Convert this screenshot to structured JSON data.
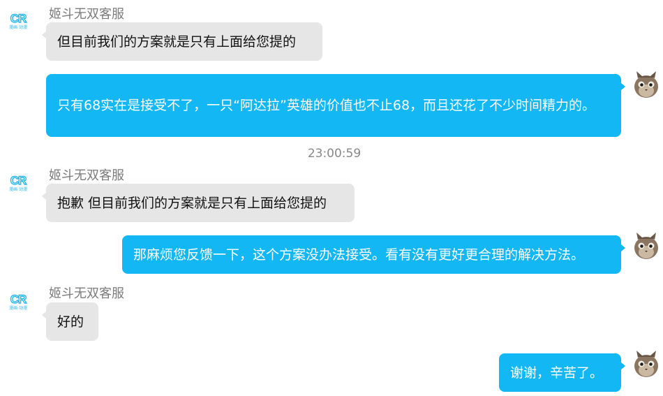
{
  "chat": {
    "agent_name": "姬斗无双客服",
    "agent_avatar": {
      "logo_text": "CR",
      "sub_text": "漫画·动漫"
    },
    "timestamp": "23:00:59",
    "messages": [
      {
        "side": "in",
        "text": "但目前我们的方案就是只有上面给您提的"
      },
      {
        "side": "out",
        "text": "只有68实在是接受不了，一只“阿达拉”英雄的价值也不止68，而且还花了不少时间精力的。"
      },
      {
        "side": "in",
        "text": "抱歉 但目前我们的方案就是只有上面给您提的"
      },
      {
        "side": "out",
        "text": "那麻烦您反馈一下，这个方案没办法接受。看有没有更好更合理的解决方法。"
      },
      {
        "side": "in",
        "text": "好的"
      },
      {
        "side": "out",
        "text": "谢谢，辛苦了。"
      }
    ]
  },
  "colors": {
    "incoming_bubble": "#e6e6e6",
    "outgoing_bubble": "#12b7f4",
    "sender_name": "#7b7b7b",
    "timestamp": "#888888"
  }
}
